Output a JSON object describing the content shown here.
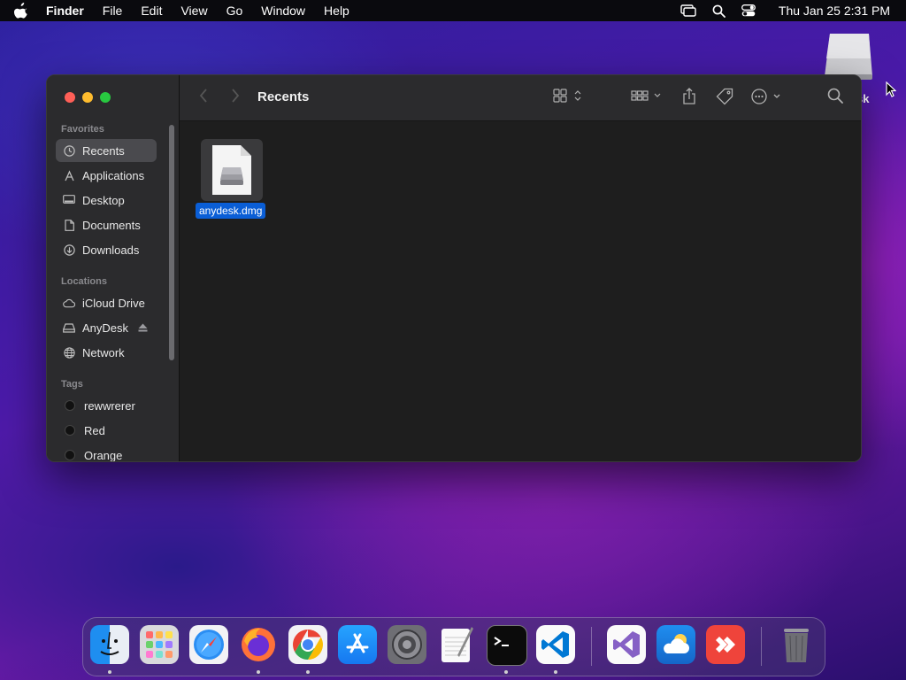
{
  "menubar": {
    "app_name": "Finder",
    "items": [
      "File",
      "Edit",
      "View",
      "Go",
      "Window",
      "Help"
    ],
    "clock": "Thu Jan 25  2:31 PM"
  },
  "desktop": {
    "drive_label": "sk"
  },
  "window": {
    "title": "Recents",
    "sidebar": {
      "favorites_header": "Favorites",
      "favorites": [
        {
          "label": "Recents",
          "icon": "clock-icon",
          "selected": true
        },
        {
          "label": "Applications",
          "icon": "applications-icon"
        },
        {
          "label": "Desktop",
          "icon": "desktop-icon"
        },
        {
          "label": "Documents",
          "icon": "document-icon"
        },
        {
          "label": "Downloads",
          "icon": "download-icon"
        }
      ],
      "locations_header": "Locations",
      "locations": [
        {
          "label": "iCloud Drive",
          "icon": "cloud-icon"
        },
        {
          "label": "AnyDesk",
          "icon": "drive-icon",
          "eject": true
        },
        {
          "label": "Network",
          "icon": "globe-icon"
        }
      ],
      "tags_header": "Tags",
      "tags": [
        {
          "label": "rewwrerer"
        },
        {
          "label": "Red"
        },
        {
          "label": "Orange"
        }
      ]
    },
    "files": [
      {
        "name": "anydesk.dmg",
        "icon": "disk-image-icon",
        "selected": true
      }
    ]
  },
  "dock": {
    "apps": [
      "finder-icon",
      "launchpad-icon",
      "safari-icon",
      "firefox-icon",
      "chrome-icon",
      "app-store-icon",
      "system-settings-icon",
      "textedit-icon",
      "terminal-icon",
      "vscode-icon",
      "visual-studio-icon",
      "weather-icon",
      "anydesk-icon",
      "trash-icon"
    ]
  },
  "colors": {
    "selection": "#0a5ed6",
    "close": "#ff5f57",
    "minimize": "#febc2e",
    "zoom": "#28c840"
  }
}
